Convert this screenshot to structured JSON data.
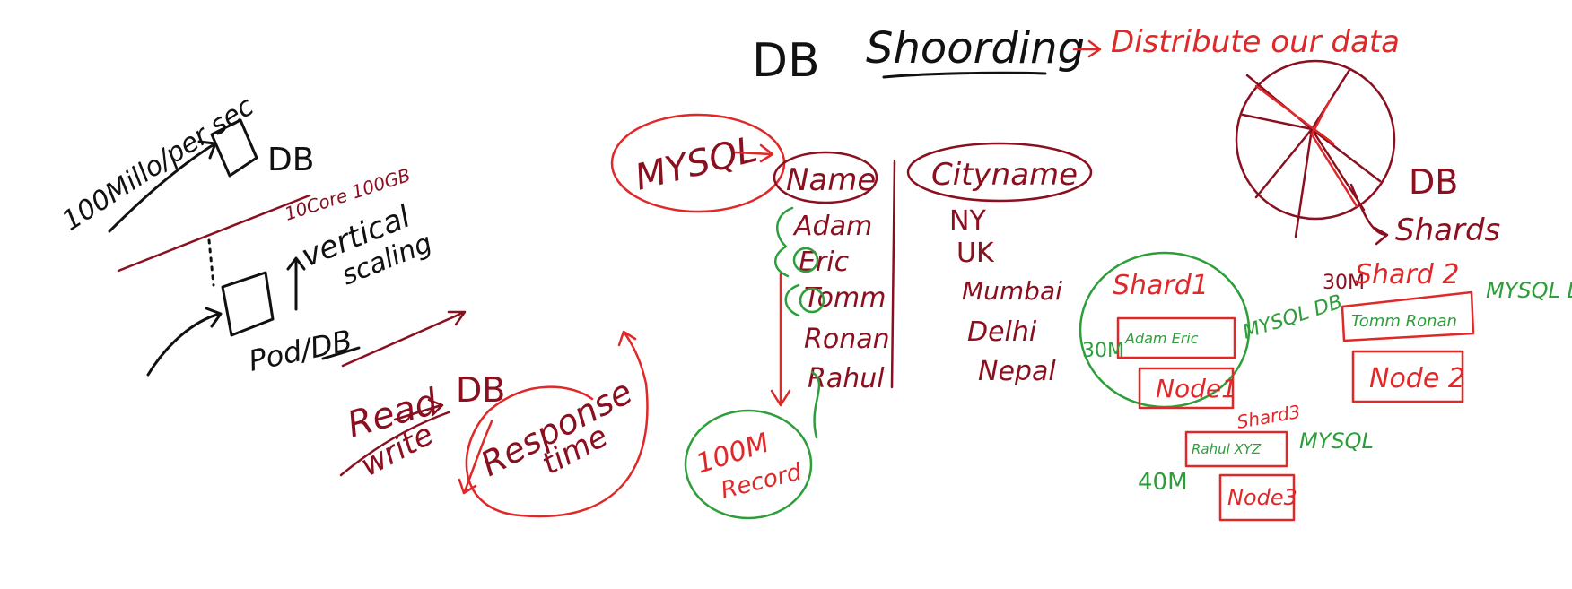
{
  "colors": {
    "black": "#111111",
    "red": "#e02828",
    "maroon": "#8a1020",
    "green": "#2e9e3a"
  },
  "title": {
    "db": "DB",
    "sharding": "Shoording",
    "note": "Distribute our data"
  },
  "left": {
    "load": "100Millo/per sec",
    "db_top": "DB",
    "ram_cores": "10Core  100GB",
    "vertical": "vertical",
    "scaling": "scaling",
    "pod_db": "Pod/DB",
    "read": "Read",
    "write": "write",
    "db_bottom": "DB",
    "response": "Response",
    "time": "time"
  },
  "table": {
    "engine": "MYSQL",
    "col_name": "Name",
    "col_city": "Cityname",
    "names": [
      "Adam",
      "Eric",
      "Tomm",
      "Ronan",
      "Rahul"
    ],
    "cities": [
      "NY",
      "UK",
      "Mumbai",
      "Delhi",
      "Nepal"
    ],
    "records_count": "100M",
    "records_label": "Record"
  },
  "shards": {
    "db": "DB",
    "shards_label": "Shards",
    "s1": {
      "title": "Shard1",
      "rows": "Adam Eric",
      "node": "Node1",
      "count": "30M",
      "engine": "MYSQL DB"
    },
    "s2": {
      "title": "Shard 2",
      "rows": "Tomm Ronan",
      "node": "Node 2",
      "count": "30M",
      "engine": "MYSQL DB"
    },
    "s3": {
      "title": "Shard3",
      "rows": "Rahul XYZ",
      "node": "Node3",
      "count": "40M",
      "engine": "MYSQL"
    }
  }
}
